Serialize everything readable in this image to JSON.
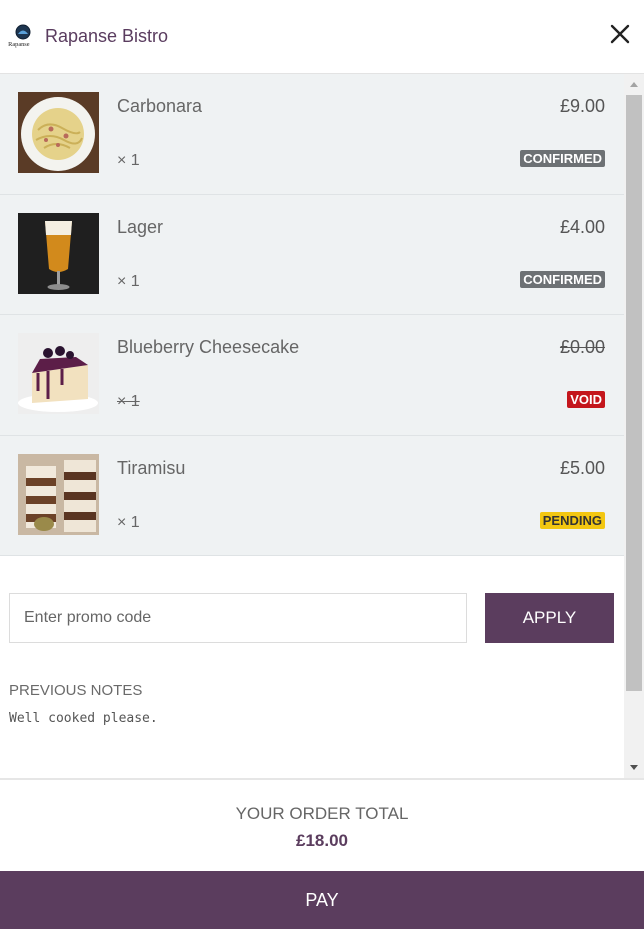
{
  "header": {
    "brand": "Rapanse Bistro",
    "logo_text": "Rapanse"
  },
  "order": {
    "items": [
      {
        "name": "Carbonara",
        "qty": "× 1",
        "price": "£9.00",
        "status": "CONFIRMED"
      },
      {
        "name": "Lager",
        "qty": "× 1",
        "price": "£4.00",
        "status": "CONFIRMED"
      },
      {
        "name": "Blueberry Cheesecake",
        "qty": "× 1",
        "price": "£0.00",
        "status": "VOID"
      },
      {
        "name": "Tiramisu",
        "qty": "× 1",
        "price": "£5.00",
        "status": "PENDING"
      }
    ]
  },
  "promo": {
    "placeholder": "Enter promo code",
    "value": "",
    "apply_label": "APPLY"
  },
  "notes": {
    "label": "PREVIOUS NOTES",
    "text": "Well cooked please."
  },
  "total": {
    "label": "YOUR ORDER TOTAL",
    "value": "£18.00"
  },
  "pay_label": "PAY",
  "colors": {
    "accent": "#5b3d5e",
    "confirmed": "#6d7174",
    "void": "#c4161c",
    "pending": "#f3c711",
    "list_bg": "#eff2f3"
  },
  "icons": {
    "close": "close-icon",
    "logo": "bistro-logo-icon"
  }
}
